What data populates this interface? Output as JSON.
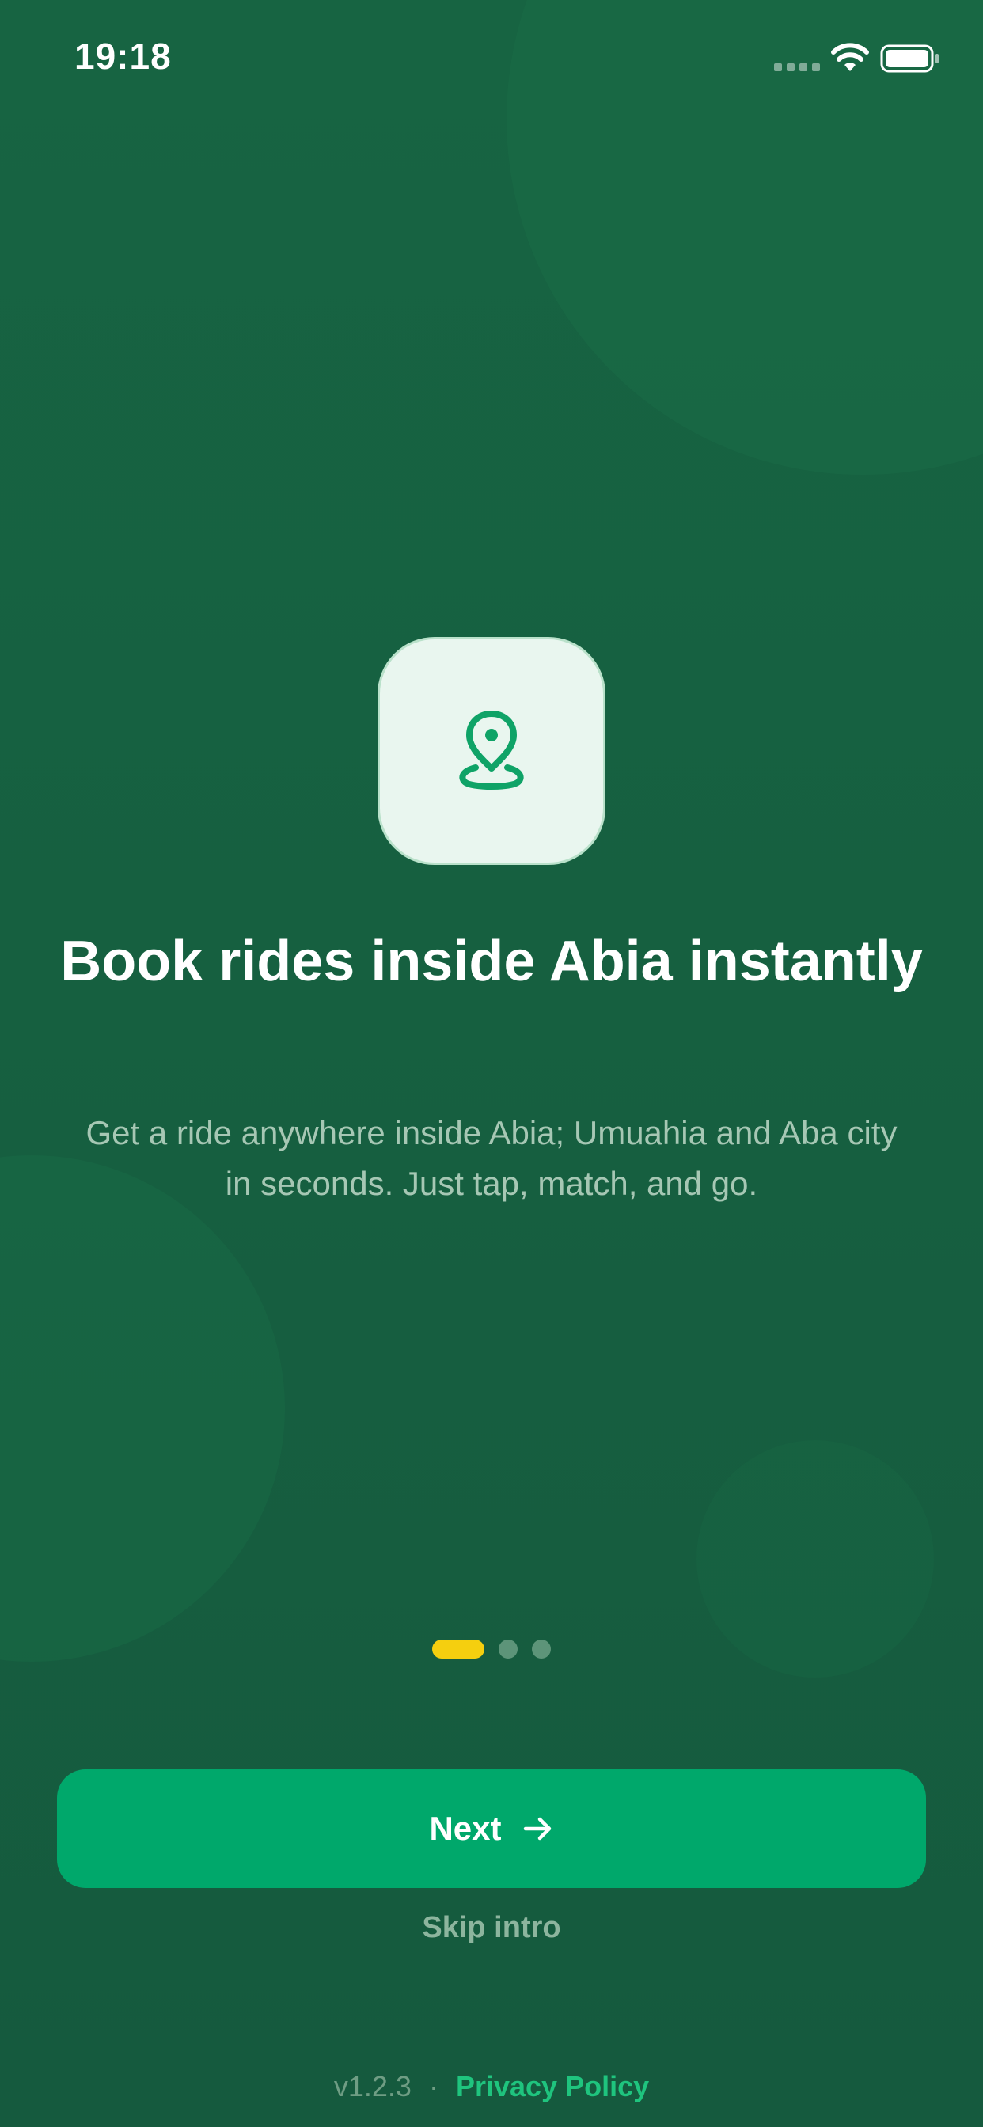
{
  "status_bar": {
    "time": "19:18",
    "icons": [
      "signal-icon",
      "wifi-icon",
      "battery-icon"
    ]
  },
  "onboarding": {
    "hero_icon": "location-pin-icon",
    "headline": "Book rides inside Abia instantly",
    "subtext": "Get a ride anywhere inside Abia; Umuahia and Aba city in seconds. Just tap, match, and go.",
    "pager": {
      "total": 3,
      "current": 1
    }
  },
  "actions": {
    "next_label": "Next",
    "next_icon": "arrow-right-icon",
    "skip_label": "Skip intro"
  },
  "footer": {
    "version": "v1.2.3",
    "separator": "·",
    "privacy_label": "Privacy Policy"
  },
  "colors": {
    "background": "#166040",
    "primary": "#00a86b",
    "accent": "#f5cf0f",
    "tile": "#e9f6ef",
    "link": "#1fc47e"
  }
}
